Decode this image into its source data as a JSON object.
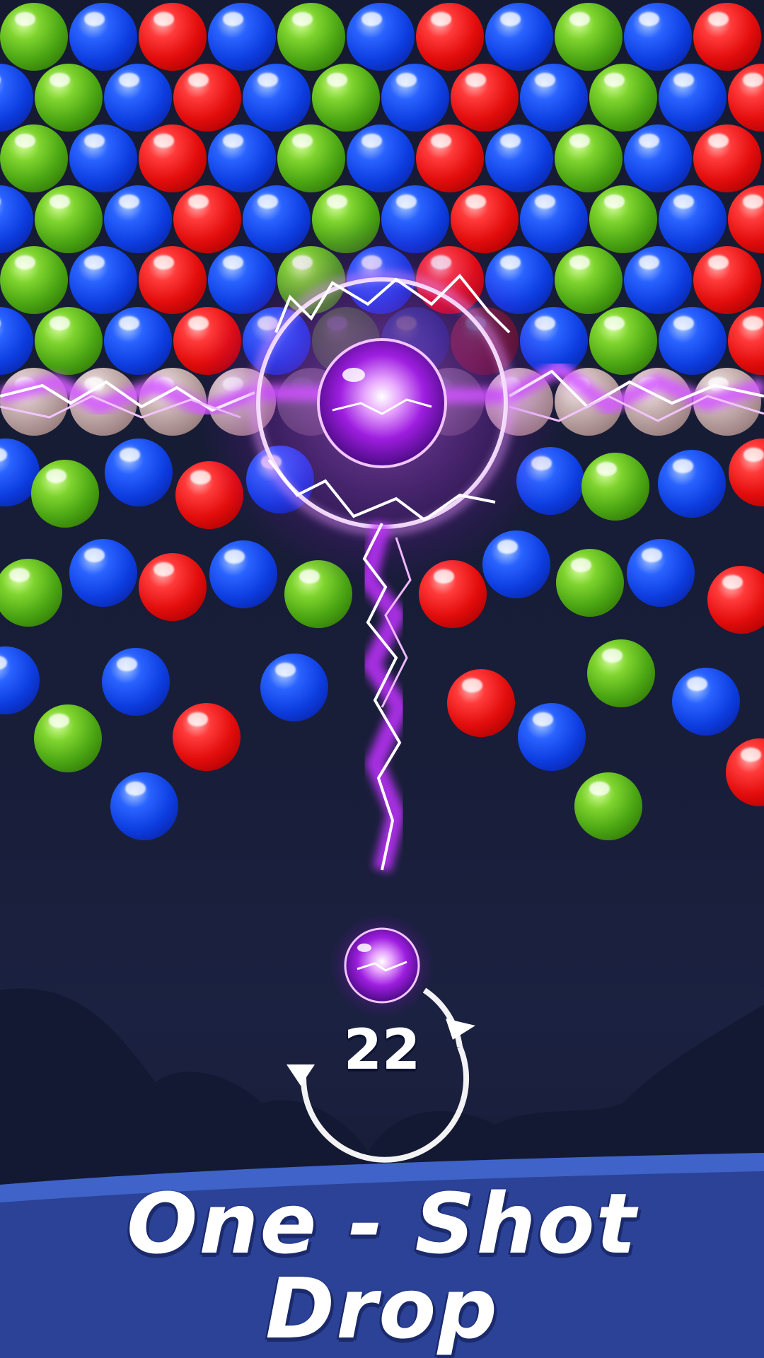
{
  "game": {
    "shots_remaining": "22",
    "current_ball": "lightning-ball"
  },
  "banner": {
    "line1": "One - Shot",
    "line2": "Drop"
  },
  "colors": {
    "red": "#e30d0d",
    "blue": "#0d3de0",
    "green": "#4aa513",
    "lightning": "#c94bff",
    "banner": "#2f4aa8"
  }
}
